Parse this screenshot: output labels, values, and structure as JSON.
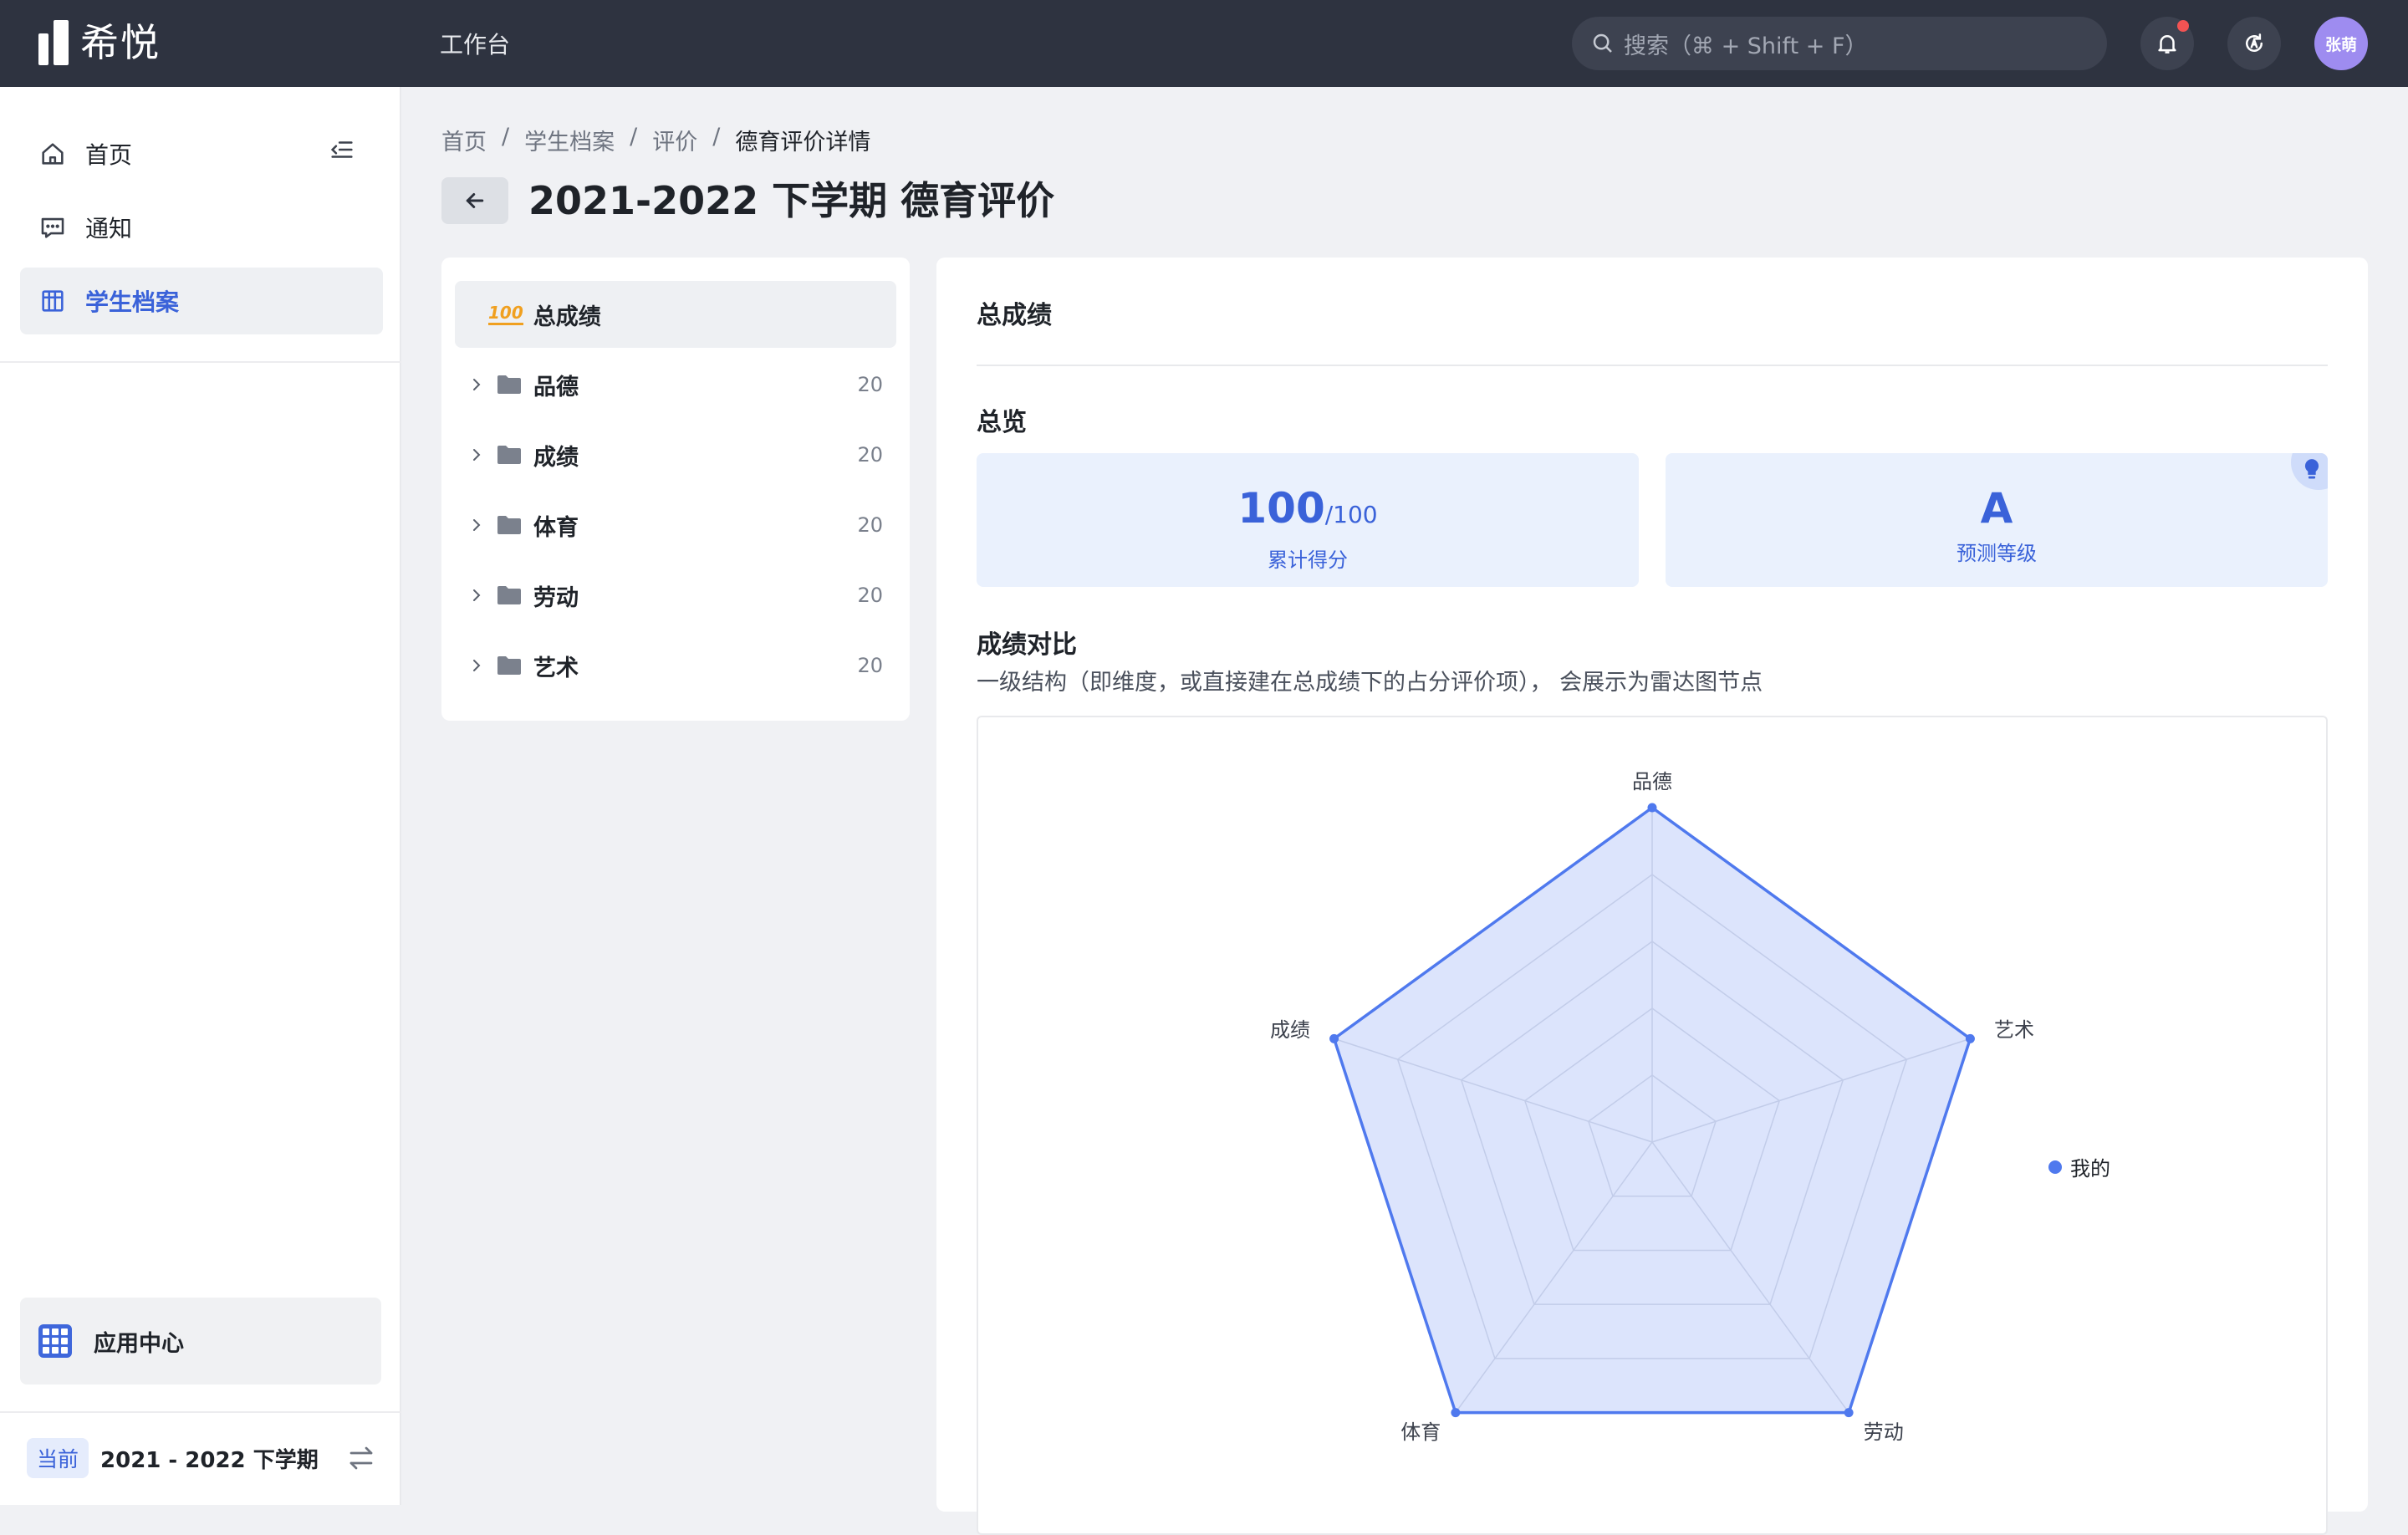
{
  "app": {
    "name": "希悦",
    "nav_workbench": "工作台"
  },
  "search": {
    "placeholder": "搜索（⌘ + Shift + F）"
  },
  "user": {
    "avatar_text": "张萌"
  },
  "sidebar": {
    "items": [
      {
        "label": "首页",
        "icon": "home-icon"
      },
      {
        "label": "通知",
        "icon": "message-icon"
      },
      {
        "label": "学生档案",
        "icon": "archive-icon",
        "active": true
      }
    ],
    "app_center": "应用中心",
    "term_badge": "当前",
    "term_text": "2021 - 2022 下学期"
  },
  "breadcrumb": [
    "首页",
    "学生档案",
    "评价",
    "德育评价详情"
  ],
  "page_title": "2021-2022 下学期 德育评价",
  "tree": {
    "root": {
      "label": "总成绩",
      "icon_text": "100"
    },
    "nodes": [
      {
        "label": "品德",
        "count": "20"
      },
      {
        "label": "成绩",
        "count": "20"
      },
      {
        "label": "体育",
        "count": "20"
      },
      {
        "label": "劳动",
        "count": "20"
      },
      {
        "label": "艺术",
        "count": "20"
      }
    ]
  },
  "panel": {
    "title": "总成绩",
    "overview_title": "总览",
    "score": {
      "value": "100",
      "total": "/100",
      "label": "累计得分"
    },
    "grade": {
      "value": "A",
      "label": "预测等级"
    },
    "compare_title": "成绩对比",
    "compare_desc": "一级结构（即维度，或直接建在总成绩下的占分评价项）， 会展示为雷达图节点"
  },
  "chart_data": {
    "type": "radar",
    "indicators": [
      "品德",
      "艺术",
      "劳动",
      "体育",
      "成绩"
    ],
    "max": 20,
    "series": [
      {
        "name": "我的",
        "values": [
          20,
          20,
          20,
          20,
          20
        ]
      }
    ],
    "color": "#4f79ee"
  },
  "colors": {
    "accent": "#3a62d9",
    "topbar": "#2e3340",
    "notification": "#f25353"
  }
}
